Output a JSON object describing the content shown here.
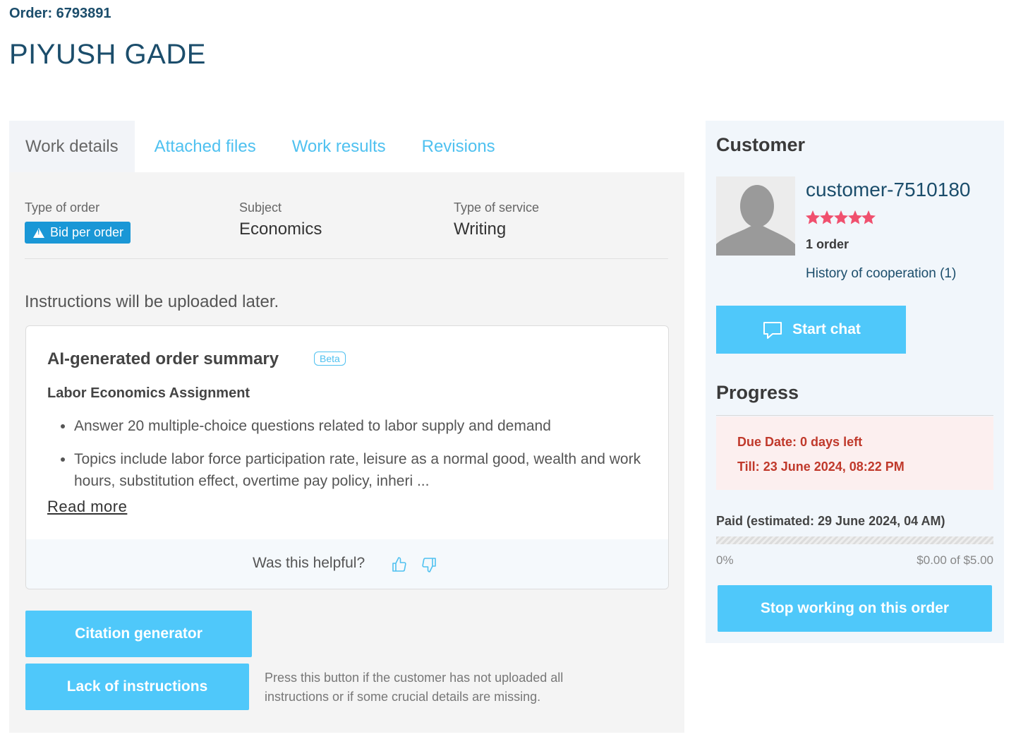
{
  "header": {
    "order_label": "Order: 6793891",
    "name": "PIYUSH GADE"
  },
  "tabs": [
    {
      "label": "Work details",
      "active": true
    },
    {
      "label": "Attached files"
    },
    {
      "label": "Work results"
    },
    {
      "label": "Revisions"
    }
  ],
  "details": {
    "type_of_order_label": "Type of order",
    "type_of_order_value": "Bid per order",
    "subject_label": "Subject",
    "subject_value": "Economics",
    "service_label": "Type of service",
    "service_value": "Writing"
  },
  "instructions_text": "Instructions will be uploaded later.",
  "ai_summary": {
    "title": "AI-generated order summary",
    "badge": "Beta",
    "subtitle": "Labor Economics Assignment",
    "bullets": [
      "Answer 20 multiple-choice questions related to labor supply and demand",
      "Topics include labor force participation rate, leisure as a normal good, wealth and work hours, substitution effect, overtime pay policy, inheri ..."
    ],
    "read_more": "Read more",
    "helpful_prompt": "Was this helpful?"
  },
  "buttons": {
    "citation": "Citation generator",
    "lack": "Lack of instructions",
    "lack_note": "Press this button if the customer has not uploaded all instructions or if some crucial details are missing."
  },
  "customer": {
    "heading": "Customer",
    "handle": "customer-7510180",
    "rating_stars": 5,
    "orders": "1 order",
    "history": "History of cooperation (1)",
    "start_chat": "Start chat"
  },
  "progress": {
    "heading": "Progress",
    "due_label": "Due Date:",
    "due_value": "0 days left",
    "till_label": "Till:",
    "till_value": "23 June 2024, 08:22 PM",
    "paid_label": "Paid (estimated: 29 June 2024, 04 AM)",
    "percent": "0%",
    "amount": "$0.00 of $5.00",
    "paid_fraction": 0,
    "stop_button": "Stop working on this order"
  },
  "colors": {
    "accent": "#4fc8fa",
    "brand_dark": "#1b4d6b",
    "badge_blue": "#1a97d6",
    "star": "#f0506e",
    "due_red": "#c0392b"
  }
}
